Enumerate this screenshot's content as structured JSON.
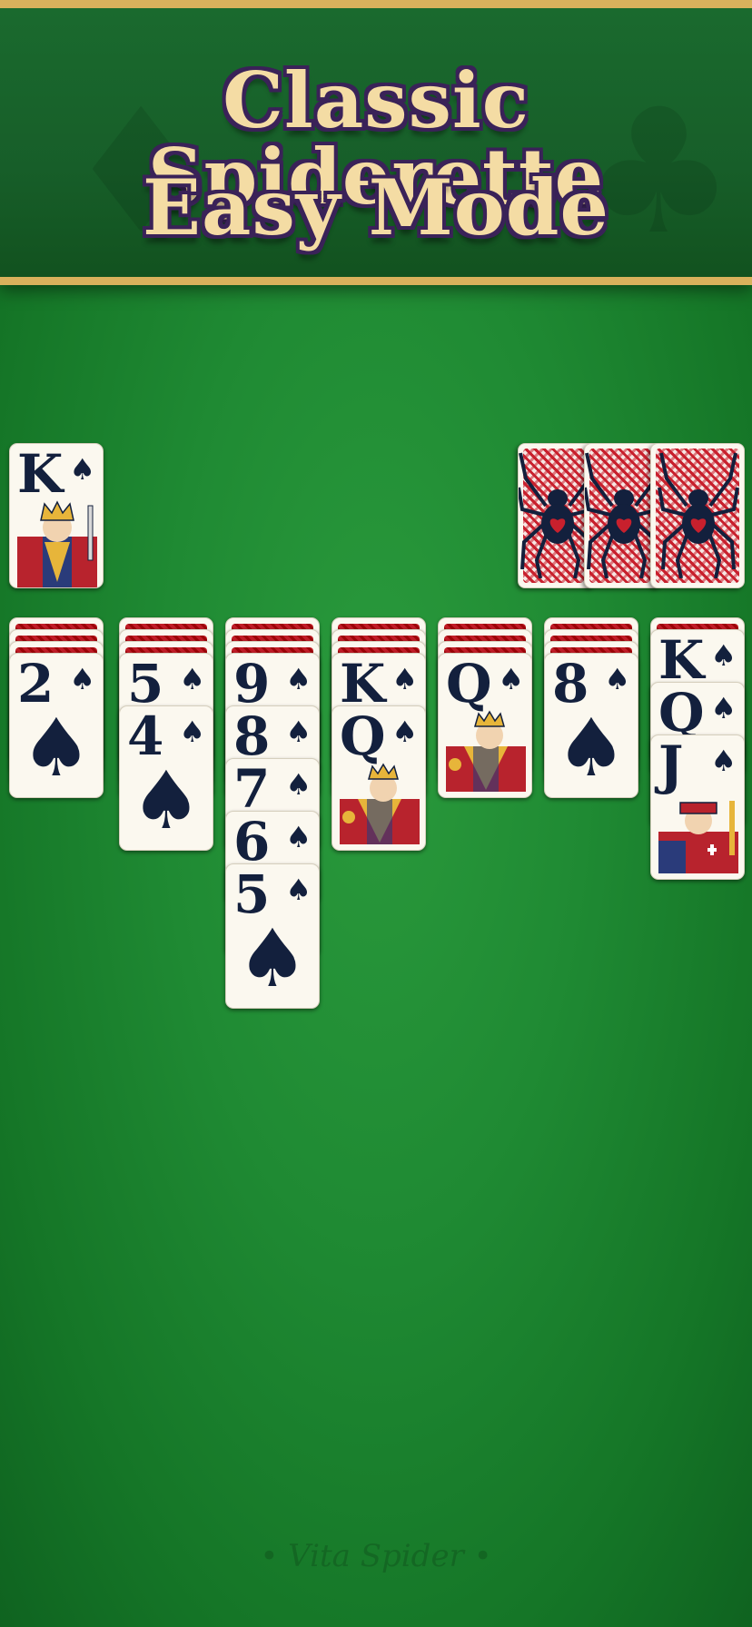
{
  "banner": {
    "line1": "Classic Spiderette",
    "line2": "Easy Mode"
  },
  "foundation": {
    "rank": "K",
    "suit": "♠"
  },
  "stock": {
    "count": 3,
    "icon": "spider-icon"
  },
  "tableau": [
    {
      "hidden": 3,
      "cards": [
        {
          "rank": "2",
          "suit": "♠"
        }
      ]
    },
    {
      "hidden": 3,
      "cards": [
        {
          "rank": "5",
          "suit": "♠"
        },
        {
          "rank": "4",
          "suit": "♠"
        }
      ]
    },
    {
      "hidden": 3,
      "cards": [
        {
          "rank": "9",
          "suit": "♠"
        },
        {
          "rank": "8",
          "suit": "♠"
        },
        {
          "rank": "7",
          "suit": "♠"
        },
        {
          "rank": "6",
          "suit": "♠"
        },
        {
          "rank": "5",
          "suit": "♠"
        }
      ]
    },
    {
      "hidden": 3,
      "cards": [
        {
          "rank": "K",
          "suit": "♠"
        },
        {
          "rank": "Q",
          "suit": "♠"
        }
      ]
    },
    {
      "hidden": 3,
      "cards": [
        {
          "rank": "Q",
          "suit": "♠"
        }
      ]
    },
    {
      "hidden": 3,
      "cards": [
        {
          "rank": "8",
          "suit": "♠"
        }
      ]
    },
    {
      "hidden": 1,
      "cards": [
        {
          "rank": "K",
          "suit": "♠"
        },
        {
          "rank": "Q",
          "suit": "♠"
        },
        {
          "rank": "J",
          "suit": "♠"
        }
      ]
    }
  ],
  "footer": "• Vita Spider •",
  "colors": {
    "felt": "#1f8a33",
    "banner_gold": "#d9b15c",
    "title_fill": "#f4dca4",
    "card_ink": "#13203d",
    "back_red": "#c8202d"
  }
}
